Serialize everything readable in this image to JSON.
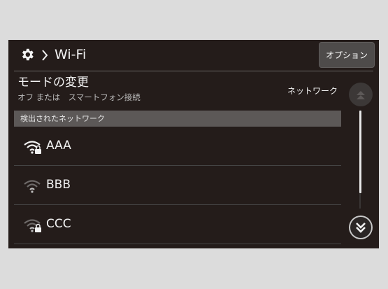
{
  "header": {
    "title": "Wi-Fi",
    "option_label": "オプション"
  },
  "mode": {
    "title": "モードの変更",
    "subtitle": "オフ または　スマートフォン接続",
    "value": "ネットワーク"
  },
  "section_label": "検出されたネットワーク",
  "networks": [
    {
      "name": "AAA",
      "signal": "strong",
      "locked": true
    },
    {
      "name": "BBB",
      "signal": "weak",
      "locked": false
    },
    {
      "name": "CCC",
      "signal": "weak",
      "locked": true
    }
  ],
  "icons": {
    "settings": "gear-icon",
    "breadcrumb": "chevron-right-icon",
    "wifi": "wifi-icon",
    "lock": "lock-icon",
    "scroll_up": "double-chevron-up-icon",
    "scroll_down": "double-chevron-down-icon"
  },
  "colors": {
    "background": "#241c1a",
    "section_bar": "#5c5857",
    "text": "#f2f2f2"
  }
}
